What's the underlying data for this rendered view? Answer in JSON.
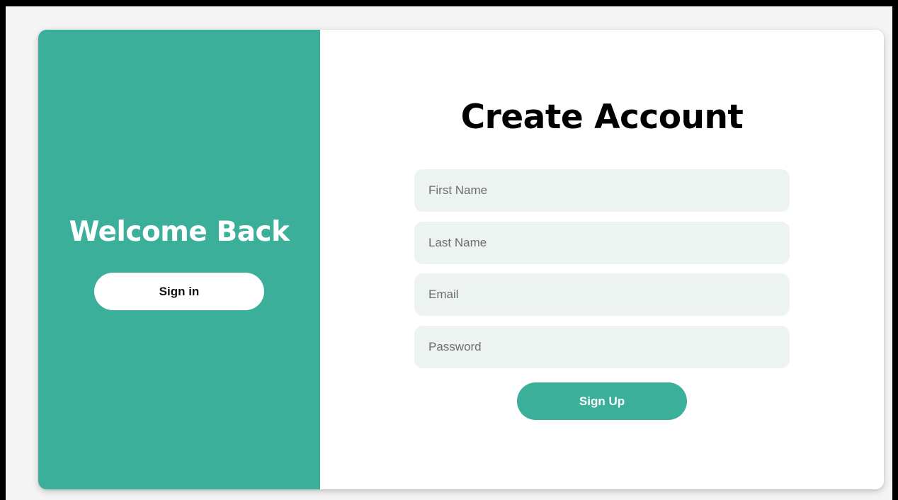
{
  "left_panel": {
    "title": "Welcome Back",
    "signin_label": "Sign in"
  },
  "right_panel": {
    "title": "Create Account",
    "fields": [
      {
        "placeholder": "First Name",
        "value": ""
      },
      {
        "placeholder": "Last Name",
        "value": ""
      },
      {
        "placeholder": "Email",
        "value": ""
      },
      {
        "placeholder": "Password",
        "value": ""
      }
    ],
    "signup_label": "Sign Up"
  },
  "colors": {
    "accent": "#3baf9a",
    "field_background": "#ecf3f1",
    "page_background": "#f4f4f4",
    "card_background": "#ffffff"
  }
}
